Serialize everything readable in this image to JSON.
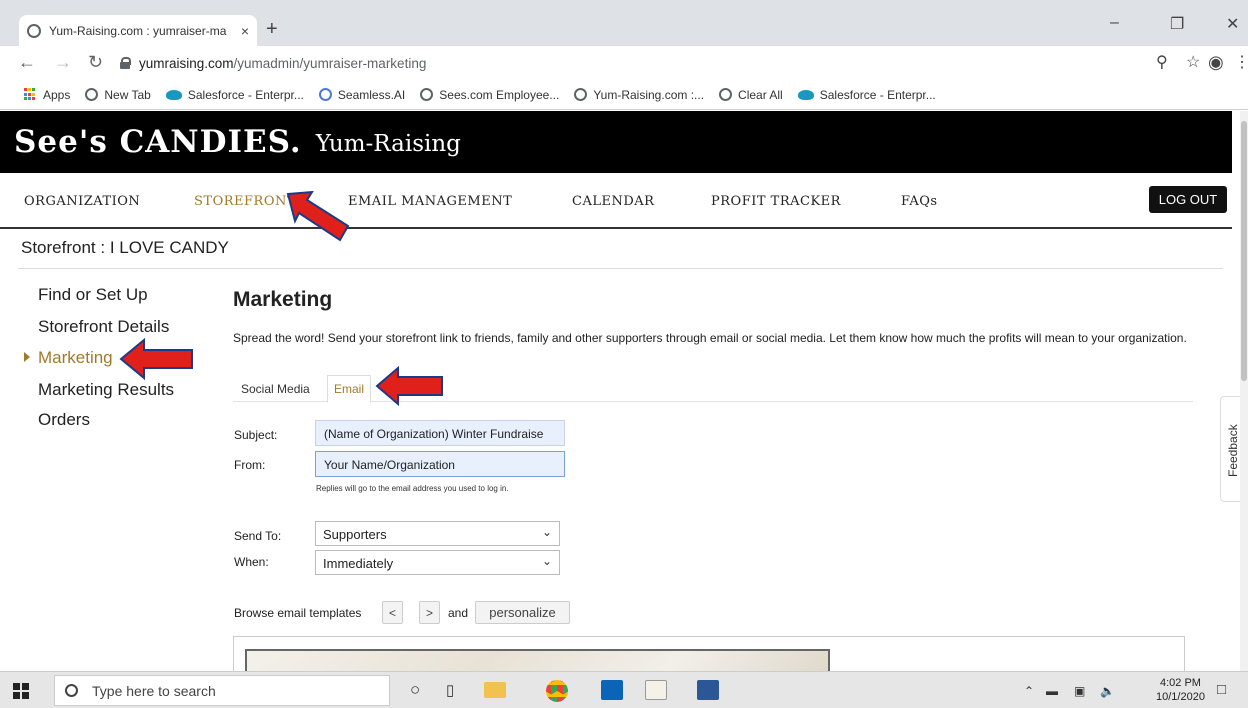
{
  "browser": {
    "tab_title": "Yum-Raising.com : yumraiser-ma",
    "tab_close": "×",
    "new_tab": "+",
    "url_host": "yumraising.com",
    "url_path": "/yumadmin/yumraiser-marketing",
    "bookmarks": [
      {
        "label": "Apps",
        "icon": "apps-grid-icon"
      },
      {
        "label": "New Tab",
        "icon": "globe-icon"
      },
      {
        "label": "Salesforce - Enterpr...",
        "icon": "salesforce-cloud-icon"
      },
      {
        "label": "Seamless.AI",
        "icon": "search-icon"
      },
      {
        "label": "Sees.com Employee...",
        "icon": "globe-icon"
      },
      {
        "label": "Yum-Raising.com :...",
        "icon": "globe-icon"
      },
      {
        "label": "Clear All",
        "icon": "globe-icon"
      },
      {
        "label": "Salesforce - Enterpr...",
        "icon": "salesforce-cloud-icon"
      }
    ]
  },
  "site": {
    "logo": "See's CANDIES.",
    "logo_sub": "Yum-Raising",
    "nav": [
      "ORGANIZATION",
      "STOREFRONT",
      "EMAIL MANAGEMENT",
      "CALENDAR",
      "PROFIT TRACKER",
      "FAQs"
    ],
    "logout": "LOG OUT",
    "accent": "#a07a2a"
  },
  "page": {
    "store_title": "Storefront : I LOVE CANDY",
    "sidenav": [
      "Find or Set Up",
      "Storefront Details",
      "Marketing",
      "Marketing Results",
      "Orders"
    ],
    "heading": "Marketing",
    "intro": "Spread the word! Send your storefront link to friends, family and other supporters through email or social media. Let them know how much the profits will mean to your organization.",
    "tabs": [
      "Social Media",
      "Email"
    ],
    "form": {
      "subject_label": "Subject:",
      "subject_value": "(Name of Organization) Winter Fundraise",
      "from_label": "From:",
      "from_value": "Your Name/Organization",
      "help": "Replies will go to the email address you used to log in.",
      "sendto_label": "Send To:",
      "sendto_value": "Supporters",
      "when_label": "When:",
      "when_value": "Immediately",
      "browse_label": "Browse email templates",
      "prev": "<",
      "next": ">",
      "and": "and",
      "personalize": "personalize"
    },
    "feedback": "Feedback"
  },
  "taskbar": {
    "search_placeholder": "Type here to search",
    "time": "4:02 PM",
    "date": "10/1/2020"
  }
}
